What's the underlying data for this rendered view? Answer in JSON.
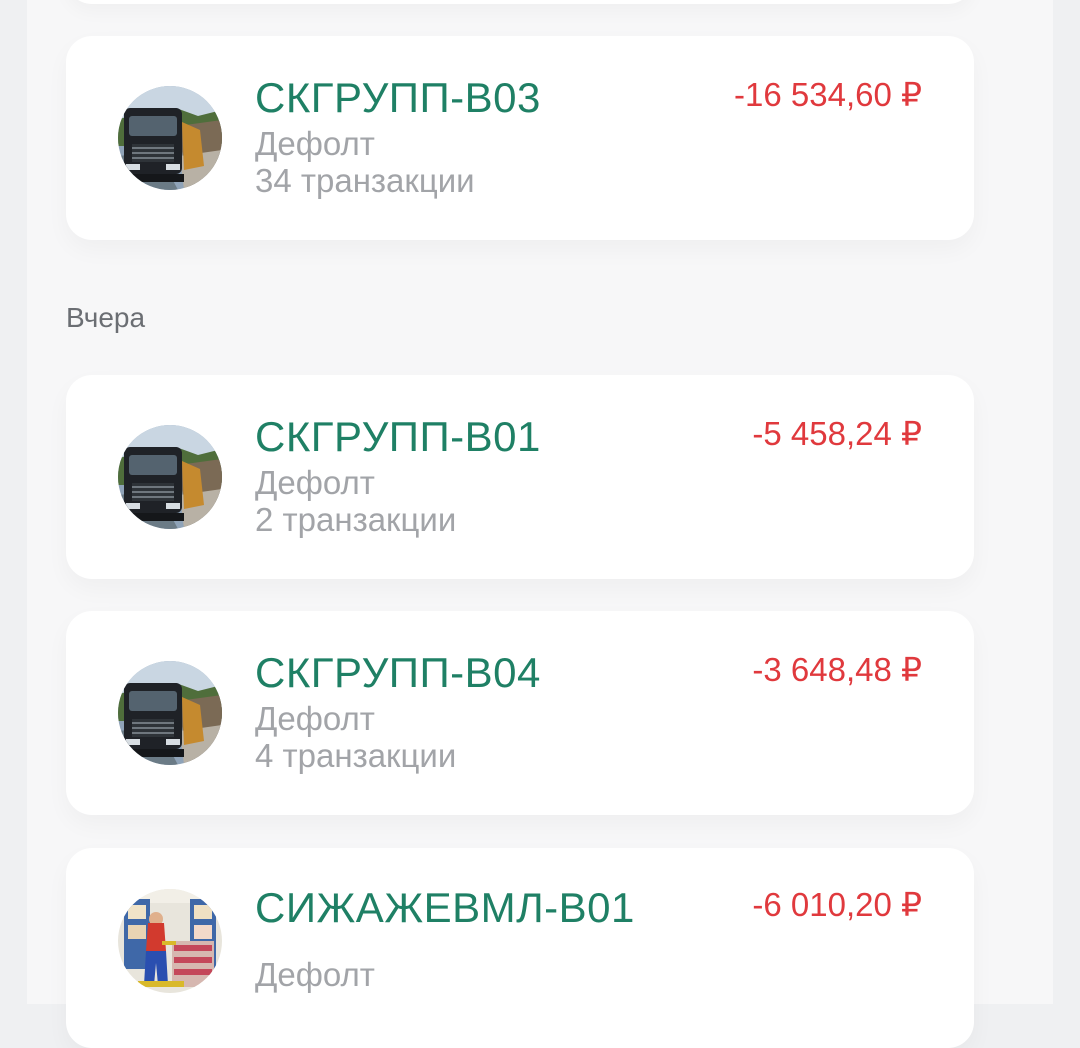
{
  "sections": [
    {
      "label": "",
      "items": [
        {
          "name": "СКГРУПП-В03",
          "category": "Дефолт",
          "transactions": "34 транзакции",
          "amount": "-16 534,60 ₽",
          "avatar": "truck"
        }
      ]
    },
    {
      "label": "Вчера",
      "items": [
        {
          "name": "СКГРУПП-В01",
          "category": "Дефолт",
          "transactions": "2 транзакции",
          "amount": "-5 458,24 ₽",
          "avatar": "truck"
        },
        {
          "name": "СКГРУПП-В04",
          "category": "Дефолт",
          "transactions": "4 транзакции",
          "amount": "-3 648,48 ₽",
          "avatar": "truck"
        },
        {
          "name": "СИЖАЖЕВМЛ-В01",
          "category": "Дефолт",
          "transactions": "",
          "amount": "-6 010,20 ₽",
          "avatar": "warehouse"
        }
      ]
    }
  ],
  "colors": {
    "name": "#1f8065",
    "amount_negative": "#e0393d",
    "secondary_text": "#a2a4a8",
    "section_label": "#6b6e73",
    "card": "#ffffff",
    "background": "#f7f7f8"
  }
}
